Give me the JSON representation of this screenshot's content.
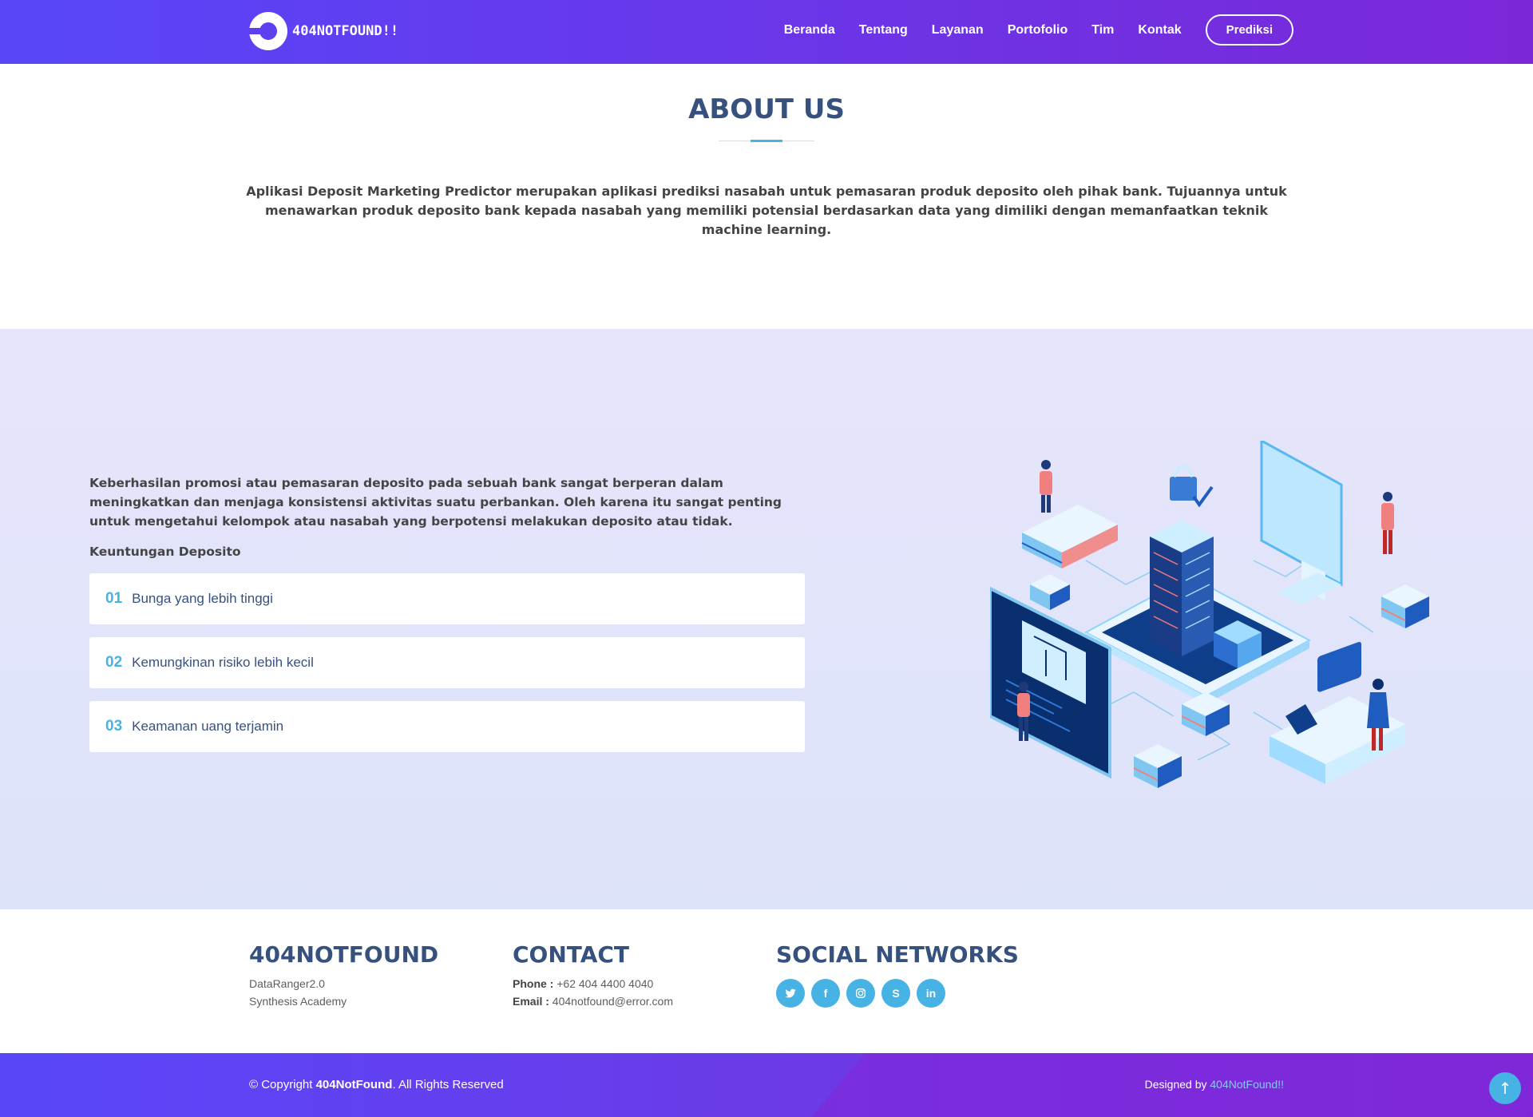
{
  "header": {
    "logo_text": "404NOTFOUND!!",
    "nav": [
      "Beranda",
      "Tentang",
      "Layanan",
      "Portofolio",
      "Tim",
      "Kontak"
    ],
    "cta": "Prediksi"
  },
  "about": {
    "title": "ABOUT US",
    "text": "Aplikasi Deposit Marketing Predictor merupakan aplikasi prediksi nasabah untuk pemasaran produk deposito oleh pihak bank. Tujuannya untuk menawarkan produk deposito bank kepada nasabah yang memiliki potensial berdasarkan data yang dimiliki dengan memanfaatkan teknik machine learning."
  },
  "features": {
    "text": "Keberhasilan promosi atau pemasaran deposito pada sebuah bank sangat berperan dalam meningkatkan dan menjaga konsistensi aktivitas suatu perbankan. Oleh karena itu sangat penting untuk mengetahui kelompok atau nasabah yang berpotensi melakukan deposito atau tidak.",
    "subtitle": "Keuntungan Deposito",
    "items": [
      {
        "num": "01",
        "label": "Bunga yang lebih tinggi"
      },
      {
        "num": "02",
        "label": "Kemungkinan risiko lebih kecil"
      },
      {
        "num": "03",
        "label": "Keamanan uang terjamin"
      }
    ]
  },
  "footer": {
    "brand": {
      "title": "404NOTFOUND",
      "line1": "DataRanger2.0",
      "line2": "Synthesis Academy"
    },
    "contact": {
      "title": "CONTACT",
      "phone_label": "Phone :",
      "phone": "+62 404 4400 4040",
      "email_label": "Email :",
      "email": "404notfound@error.com"
    },
    "social": {
      "title": "SOCIAL NETWORKS",
      "icons": [
        "twitter-icon",
        "facebook-icon",
        "instagram-icon",
        "skype-icon",
        "linkedin-icon"
      ]
    },
    "copyright_prefix": "© Copyright",
    "copyright_brand": "404NotFound",
    "copyright_suffix": ". All Rights Reserved",
    "designed_prefix": "Designed by",
    "designed_by": "404NotFound!!"
  },
  "colors": {
    "accent": "#47b2e4",
    "heading": "#37517e",
    "gradient_start": "#5846f9",
    "gradient_end": "#7b27d8"
  }
}
